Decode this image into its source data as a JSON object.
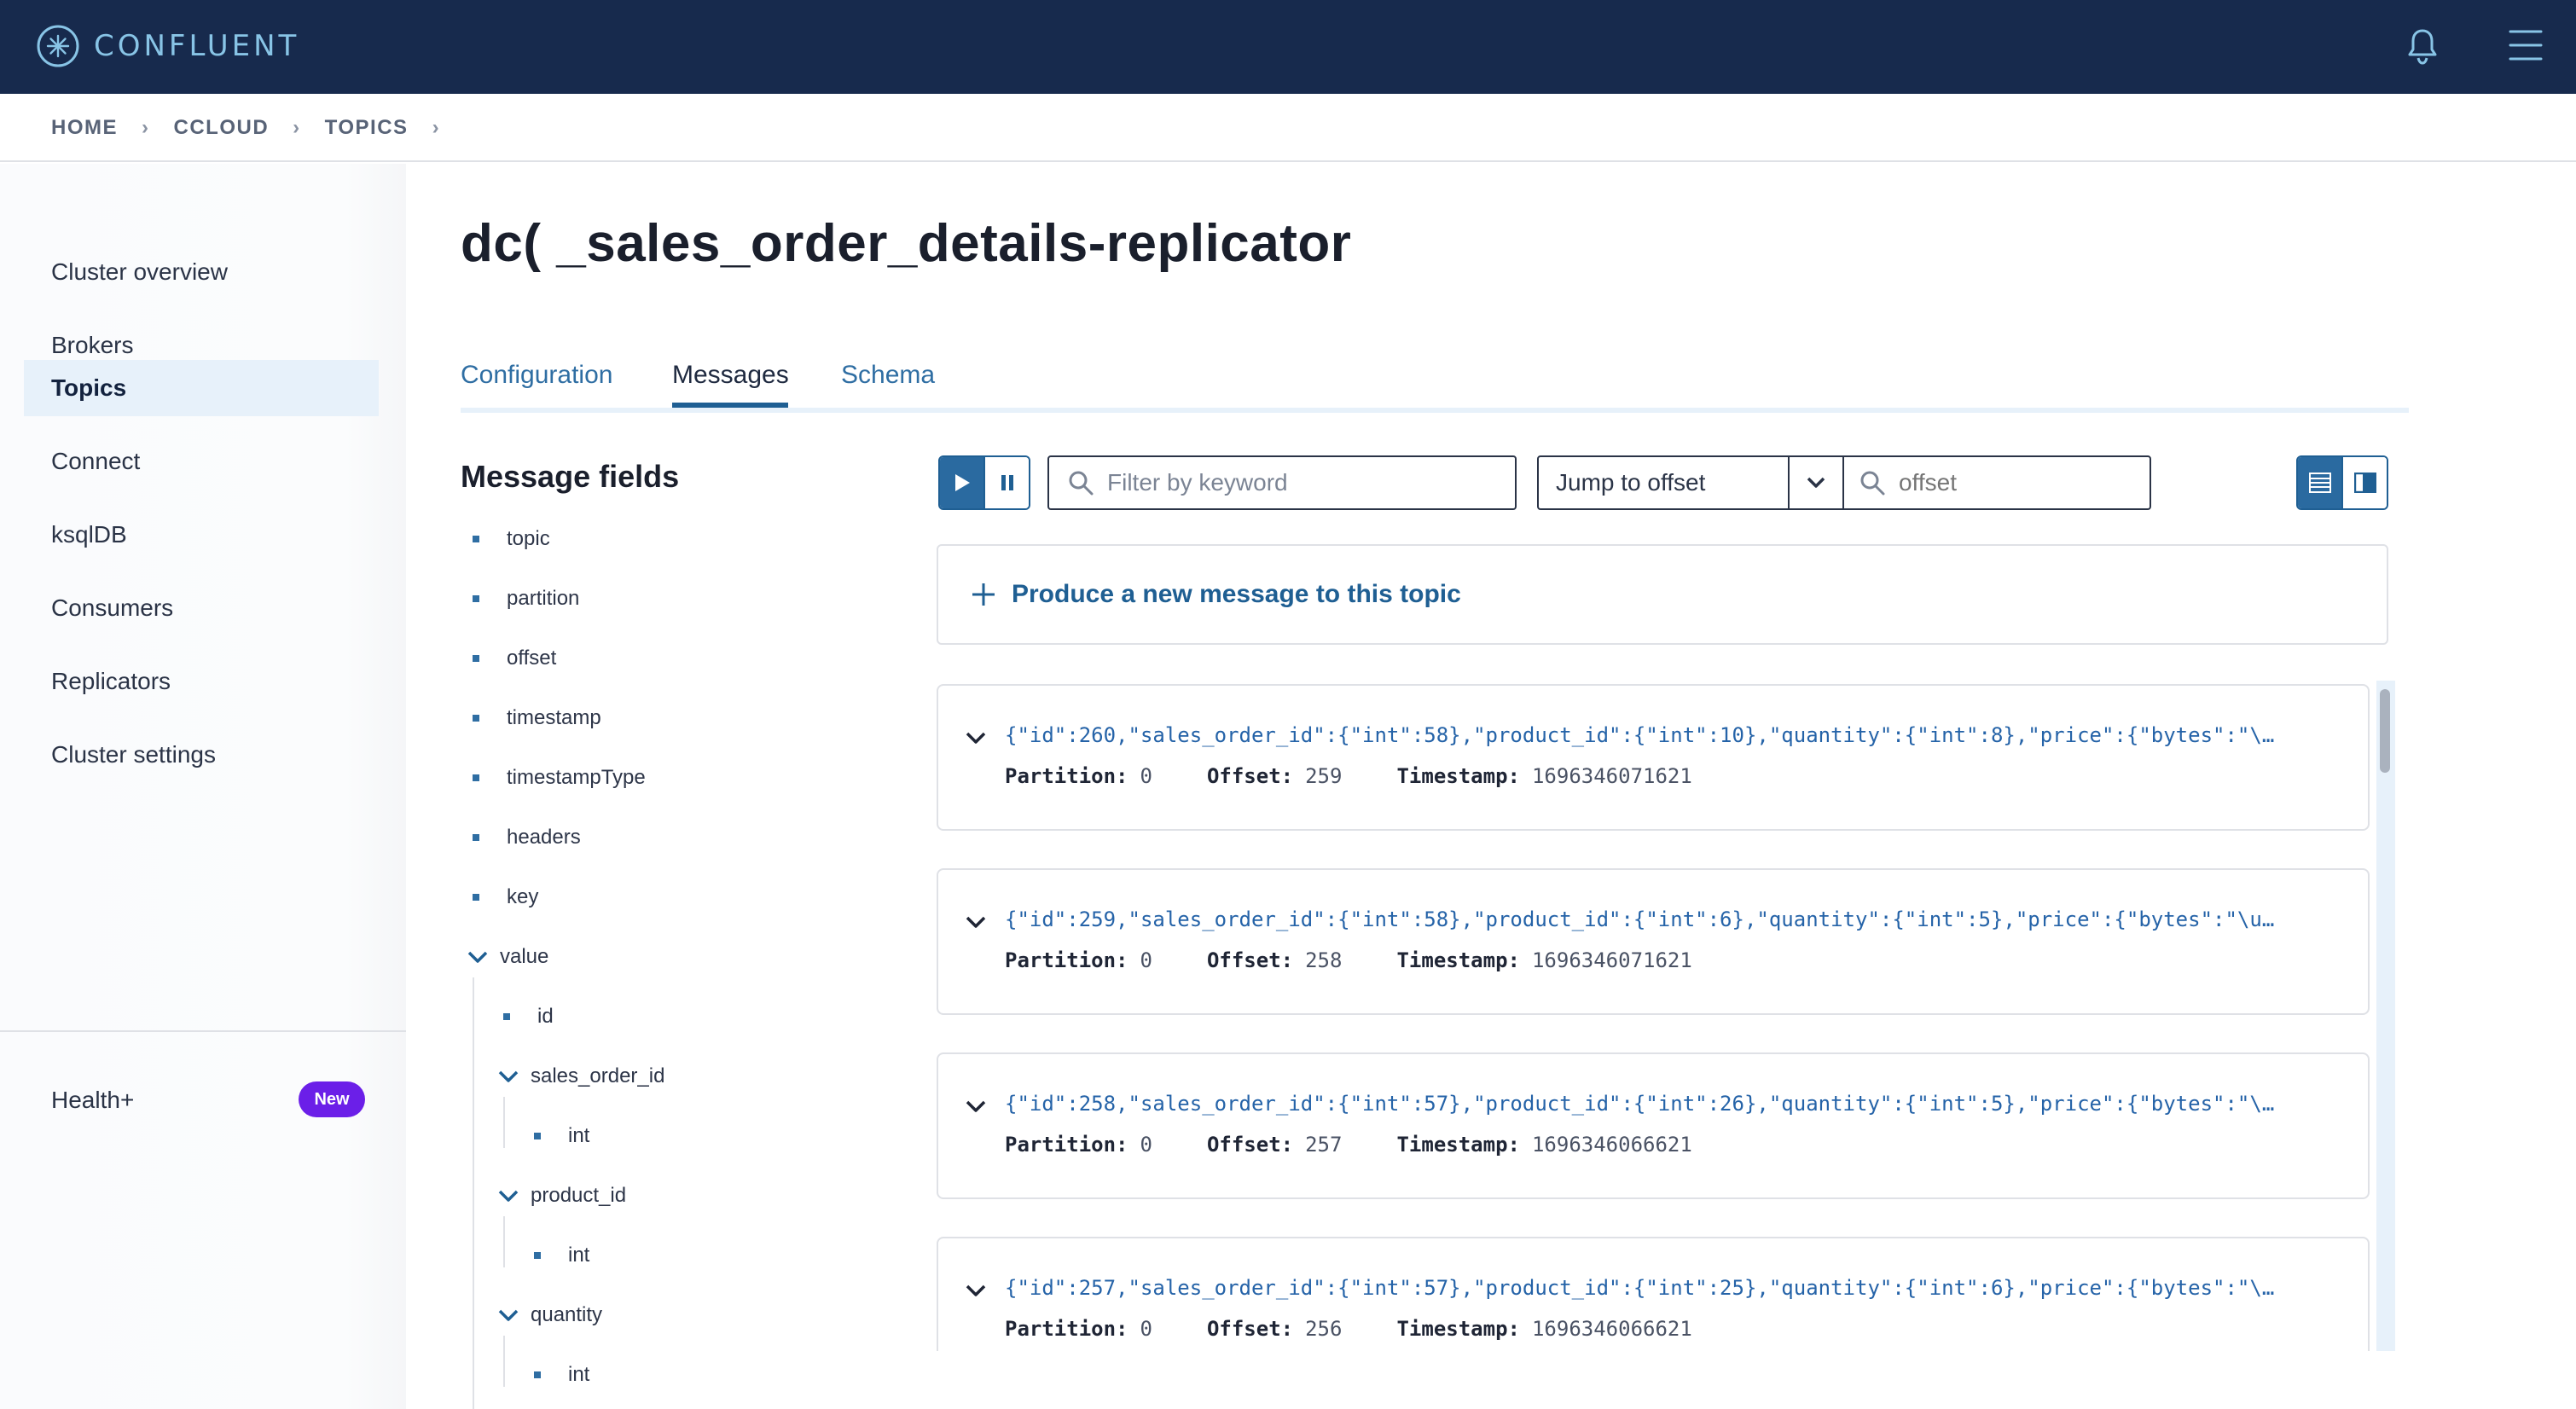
{
  "app": {
    "logo_text": "CONFLUENT"
  },
  "breadcrumb": [
    "HOME",
    "CCLOUD",
    "TOPICS"
  ],
  "sidebar": {
    "items": [
      {
        "label": "Cluster overview"
      },
      {
        "label": "Brokers"
      },
      {
        "label": "Topics",
        "active": true
      },
      {
        "label": "Connect"
      },
      {
        "label": "ksqlDB"
      },
      {
        "label": "Consumers"
      },
      {
        "label": "Replicators"
      },
      {
        "label": "Cluster settings"
      }
    ],
    "health_label": "Health+",
    "health_badge": "New"
  },
  "page": {
    "title": "dc(   _sales_order_details-replicator"
  },
  "tabs": [
    {
      "label": "Configuration"
    },
    {
      "label": "Messages",
      "active": true
    },
    {
      "label": "Schema"
    }
  ],
  "message_fields": {
    "title": "Message fields",
    "fields": [
      "topic",
      "partition",
      "offset",
      "timestamp",
      "timestampType",
      "headers",
      "key",
      "value",
      "id",
      "sales_order_id",
      "int",
      "product_id",
      "int",
      "quantity",
      "int"
    ]
  },
  "controls": {
    "filter_placeholder": "Filter by keyword",
    "jump_label": "Jump to offset",
    "offset_placeholder": "offset",
    "produce_label": "Produce a new message to this topic"
  },
  "labels": {
    "partition": "Partition:",
    "offset": "Offset:",
    "timestamp": "Timestamp:"
  },
  "messages": [
    {
      "json": "{\"id\":260,\"sales_order_id\":{\"int\":58},\"product_id\":{\"int\":10},\"quantity\":{\"int\":8},\"price\":{\"bytes\":\"\\…",
      "partition": "0",
      "offset": "259",
      "timestamp": "1696346071621"
    },
    {
      "json": "{\"id\":259,\"sales_order_id\":{\"int\":58},\"product_id\":{\"int\":6},\"quantity\":{\"int\":5},\"price\":{\"bytes\":\"\\u…",
      "partition": "0",
      "offset": "258",
      "timestamp": "1696346071621"
    },
    {
      "json": "{\"id\":258,\"sales_order_id\":{\"int\":57},\"product_id\":{\"int\":26},\"quantity\":{\"int\":5},\"price\":{\"bytes\":\"\\…",
      "partition": "0",
      "offset": "257",
      "timestamp": "1696346066621"
    },
    {
      "json": "{\"id\":257,\"sales_order_id\":{\"int\":57},\"product_id\":{\"int\":25},\"quantity\":{\"int\":6},\"price\":{\"bytes\":\"\\…",
      "partition": "0",
      "offset": "256",
      "timestamp": "1696346066621"
    }
  ],
  "icons": {
    "logo": "confluent-logo-icon",
    "notifications": "bell-icon",
    "menu": "hamburger-menu-icon",
    "play": "play-icon",
    "pause": "pause-icon",
    "search": "search-icon",
    "list_view": "list-view-icon",
    "split_view": "split-view-icon",
    "add": "plus-icon",
    "expand": "chevron-down-icon"
  },
  "colors": {
    "topbar": "#172a4d",
    "accent": "#2a6aa0",
    "link": "#2f6ea3",
    "badge": "#6b1fe8",
    "active_nav_bg": "#e7f1fa"
  }
}
